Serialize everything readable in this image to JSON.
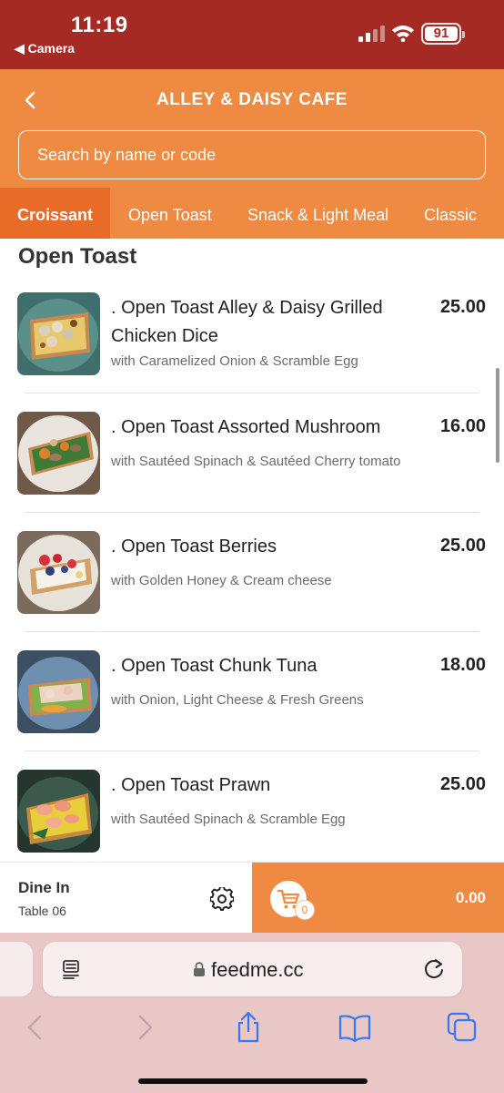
{
  "status_bar": {
    "time": "11:19",
    "back_app": "◀ Camera",
    "battery": "91"
  },
  "header": {
    "title": "ALLEY & DAISY CAFE",
    "search_placeholder": "Search by name or code",
    "tabs": [
      {
        "label": "Croissant",
        "active": true
      },
      {
        "label": "Open Toast",
        "active": false
      },
      {
        "label": "Snack & Light Meal",
        "active": false
      },
      {
        "label": "Classic",
        "active": false
      }
    ]
  },
  "section": {
    "title": "Open Toast"
  },
  "items": [
    {
      "name": ". Open Toast Alley & Daisy Grilled Chicken Dice",
      "desc": "with Caramelized Onion & Scramble Egg",
      "price": "25.00"
    },
    {
      "name": ". Open Toast Assorted Mushroom",
      "desc": "with Sautéed Spinach & Sautéed Cherry tomato",
      "price": "16.00"
    },
    {
      "name": ". Open Toast Berries",
      "desc": "with Golden Honey & Cream cheese",
      "price": "25.00"
    },
    {
      "name": ". Open Toast Chunk Tuna",
      "desc": "with Onion, Light Cheese & Fresh Greens",
      "price": "18.00"
    },
    {
      "name": ". Open Toast Prawn",
      "desc": "with Sautéed Spinach & Scramble Egg",
      "price": "25.00"
    }
  ],
  "order_bar": {
    "mode": "Dine In",
    "table": "Table 06",
    "cart_count": "0",
    "total": "0.00"
  },
  "browser": {
    "url": "feedme.cc"
  },
  "colors": {
    "status_bar": "#a52a24",
    "brand_orange": "#ef8a43",
    "active_tab": "#e96b28",
    "safari_bg": "#e9c7c6",
    "ios_blue": "#3478f6"
  }
}
